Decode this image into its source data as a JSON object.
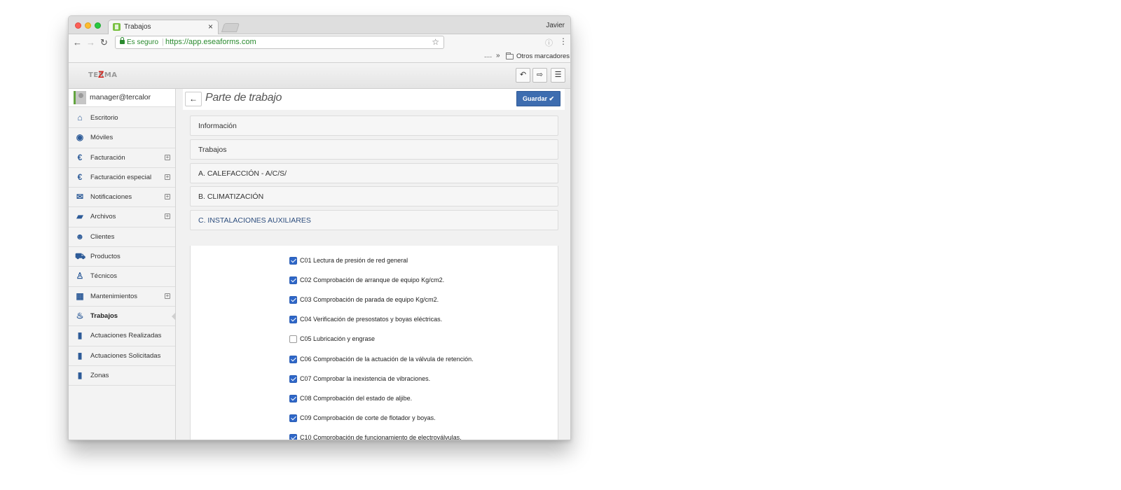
{
  "browser": {
    "tab_title": "Trabajos",
    "tab_close": "×",
    "profile_name": "Javier",
    "secure_label": "Es seguro",
    "url": "https://app.eseaforms.com",
    "bookmarks_overflow": "....",
    "bookmarks_chevron": "»",
    "bookmarks_folder": "Otros marcadores"
  },
  "header": {
    "logo_text": "TERMA",
    "buttons": [
      {
        "icon": "undo-icon",
        "glyph": "↶"
      },
      {
        "icon": "logout-icon",
        "glyph": "⇨"
      },
      {
        "icon": "hamburger-menu-icon",
        "glyph": "☰"
      }
    ]
  },
  "sidebar": {
    "user": "manager@tercalor",
    "items": [
      {
        "label": "Escritorio",
        "icon": "home-icon",
        "glyph": "⌂",
        "expandable": false
      },
      {
        "label": "Móviles",
        "icon": "android-icon",
        "glyph": "◉",
        "expandable": false
      },
      {
        "label": "Facturación",
        "icon": "euro-icon",
        "glyph": "€",
        "expandable": true
      },
      {
        "label": "Facturación especial",
        "icon": "euro-icon",
        "glyph": "€",
        "expandable": true
      },
      {
        "label": "Notificaciones",
        "icon": "envelope-icon",
        "glyph": "✉",
        "expandable": true
      },
      {
        "label": "Archivos",
        "icon": "book-icon",
        "glyph": "▰",
        "expandable": true
      },
      {
        "label": "Clientes",
        "icon": "users-icon",
        "glyph": "☻",
        "expandable": false
      },
      {
        "label": "Productos",
        "icon": "cart-icon",
        "glyph": "⛟",
        "expandable": false
      },
      {
        "label": "Técnicos",
        "icon": "person-icon",
        "glyph": "♙",
        "expandable": false
      },
      {
        "label": "Mantenimientos",
        "icon": "calendar-icon",
        "glyph": "▦",
        "expandable": true
      },
      {
        "label": "Trabajos",
        "icon": "fire-extinguisher-icon",
        "glyph": "♨",
        "expandable": false,
        "active": true
      },
      {
        "label": "Actuaciones Realizadas",
        "icon": "file-icon",
        "glyph": "▮",
        "expandable": false
      },
      {
        "label": "Actuaciones Solicitadas",
        "icon": "file-icon",
        "glyph": "▮",
        "expandable": false
      },
      {
        "label": "Zonas",
        "icon": "file-icon",
        "glyph": "▮",
        "expandable": false
      }
    ],
    "expand_glyph": "+"
  },
  "main": {
    "back_glyph": "←",
    "title": "Parte de trabajo",
    "save_label": "Guardar ✔",
    "panels": [
      "Información",
      "Trabajos",
      "A. CALEFACCIÓN - A/C/S/",
      "B. CLIMATIZACIÓN",
      "C. INSTALACIONES AUXILIARES"
    ],
    "checklist": [
      {
        "label": "C01 Lectura de presión de red general",
        "checked": true
      },
      {
        "label": "C02 Comprobación de arranque de equipo Kg/cm2.",
        "checked": true
      },
      {
        "label": "C03 Comprobación de parada de equipo Kg/cm2.",
        "checked": true
      },
      {
        "label": "C04 Verificación de presostatos y boyas eléctricas.",
        "checked": true
      },
      {
        "label": "C05 Lubricación y engrase",
        "checked": false
      },
      {
        "label": "C06 Comprobación de la actuación de la válvula de retención.",
        "checked": true
      },
      {
        "label": "C07 Comprobar la inexistencia de vibraciones.",
        "checked": true
      },
      {
        "label": "C08 Comprobación del estado de aljibe.",
        "checked": true
      },
      {
        "label": "C09 Comprobación de corte de flotador y boyas.",
        "checked": true
      },
      {
        "label": "C10 Comprobación de funcionamiento de electroválvulas.",
        "checked": true
      }
    ]
  }
}
